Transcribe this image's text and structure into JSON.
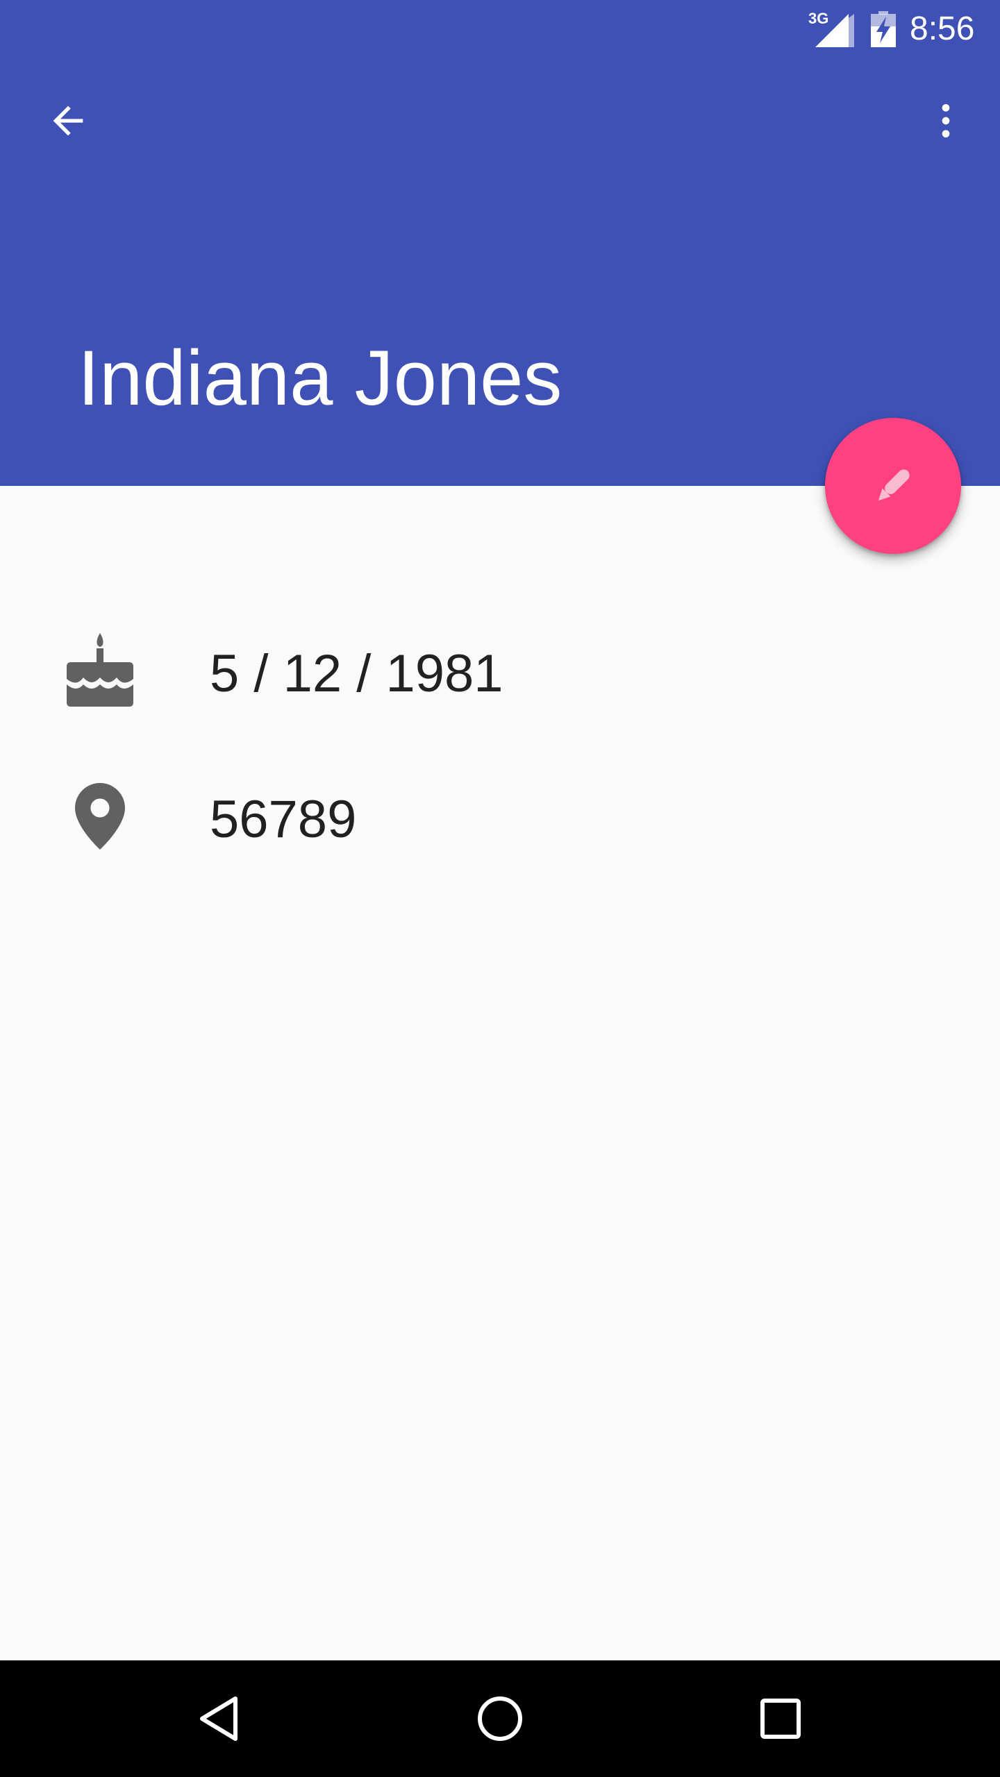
{
  "status_bar": {
    "network": "3G",
    "time": "8:56",
    "signal_icon": "signal-icon",
    "battery_icon": "battery-charging-icon"
  },
  "toolbar": {
    "back_icon": "arrow-back-icon",
    "menu_icon": "more-vert-icon"
  },
  "contact": {
    "name": "Indiana Jones",
    "birthday": "5 / 12 / 1981",
    "location": "56789"
  },
  "fab": {
    "icon": "edit-pencil-icon"
  },
  "nav": {
    "back_icon": "nav-back-icon",
    "home_icon": "nav-home-icon",
    "recents_icon": "nav-recents-icon"
  },
  "colors": {
    "primary": "#3f51b5",
    "accent": "#ff4081",
    "background": "#fafafa",
    "text": "#212121",
    "icon": "#616161",
    "nav_bar": "#000000"
  }
}
